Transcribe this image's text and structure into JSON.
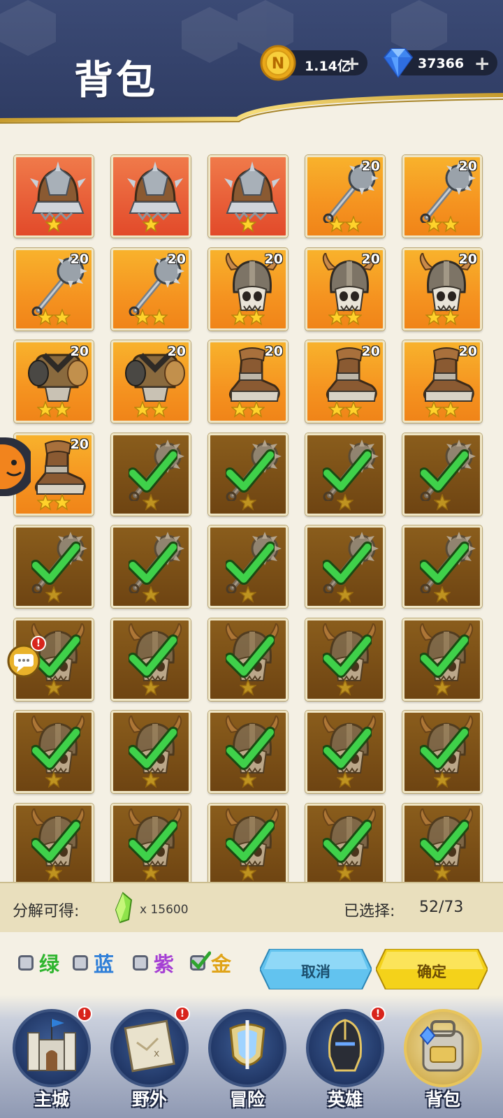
{
  "header": {
    "title": "背包",
    "gold": {
      "value": "1.14亿",
      "icon": "gold-coin-icon",
      "add_icon": "plus-icon"
    },
    "diamond": {
      "value": "37366",
      "icon": "diamond-icon",
      "add_icon": "plus-icon"
    }
  },
  "items": [
    {
      "type": "helmet-spiked",
      "rarity": "red",
      "stars": 1,
      "level": "",
      "selected": false
    },
    {
      "type": "helmet-spiked",
      "rarity": "red",
      "stars": 1,
      "level": "",
      "selected": false
    },
    {
      "type": "helmet-spiked",
      "rarity": "red",
      "stars": 1,
      "level": "",
      "selected": false
    },
    {
      "type": "mace",
      "rarity": "orange",
      "stars": 2,
      "level": "20",
      "selected": false
    },
    {
      "type": "mace",
      "rarity": "orange",
      "stars": 2,
      "level": "20",
      "selected": false
    },
    {
      "type": "mace",
      "rarity": "orange",
      "stars": 2,
      "level": "20",
      "selected": false
    },
    {
      "type": "mace",
      "rarity": "orange",
      "stars": 2,
      "level": "20",
      "selected": false
    },
    {
      "type": "horned-helmet",
      "rarity": "orange",
      "stars": 2,
      "level": "20",
      "selected": false
    },
    {
      "type": "horned-helmet",
      "rarity": "orange",
      "stars": 2,
      "level": "20",
      "selected": false
    },
    {
      "type": "horned-helmet",
      "rarity": "orange",
      "stars": 2,
      "level": "20",
      "selected": false
    },
    {
      "type": "chest-armor",
      "rarity": "orange",
      "stars": 2,
      "level": "20",
      "selected": false
    },
    {
      "type": "chest-armor",
      "rarity": "orange",
      "stars": 2,
      "level": "20",
      "selected": false
    },
    {
      "type": "boot",
      "rarity": "orange",
      "stars": 2,
      "level": "20",
      "selected": false
    },
    {
      "type": "boot",
      "rarity": "orange",
      "stars": 2,
      "level": "20",
      "selected": false
    },
    {
      "type": "boot",
      "rarity": "orange",
      "stars": 2,
      "level": "20",
      "selected": false
    },
    {
      "type": "boot",
      "rarity": "orange",
      "stars": 2,
      "level": "20",
      "selected": false
    },
    {
      "type": "mace",
      "rarity": "gold",
      "stars": 1,
      "level": "",
      "selected": true
    },
    {
      "type": "mace",
      "rarity": "gold",
      "stars": 1,
      "level": "",
      "selected": true
    },
    {
      "type": "mace",
      "rarity": "gold",
      "stars": 1,
      "level": "",
      "selected": true
    },
    {
      "type": "mace",
      "rarity": "gold",
      "stars": 1,
      "level": "",
      "selected": true
    },
    {
      "type": "mace",
      "rarity": "gold",
      "stars": 1,
      "level": "",
      "selected": true
    },
    {
      "type": "mace",
      "rarity": "gold",
      "stars": 1,
      "level": "",
      "selected": true
    },
    {
      "type": "mace",
      "rarity": "gold",
      "stars": 1,
      "level": "",
      "selected": true
    },
    {
      "type": "mace",
      "rarity": "gold",
      "stars": 1,
      "level": "",
      "selected": true
    },
    {
      "type": "mace",
      "rarity": "gold",
      "stars": 1,
      "level": "",
      "selected": true
    },
    {
      "type": "horned-helmet",
      "rarity": "gold",
      "stars": 1,
      "level": "",
      "selected": true
    },
    {
      "type": "horned-helmet",
      "rarity": "gold",
      "stars": 1,
      "level": "",
      "selected": true
    },
    {
      "type": "horned-helmet",
      "rarity": "gold",
      "stars": 1,
      "level": "",
      "selected": true
    },
    {
      "type": "horned-helmet",
      "rarity": "gold",
      "stars": 1,
      "level": "",
      "selected": true
    },
    {
      "type": "horned-helmet",
      "rarity": "gold",
      "stars": 1,
      "level": "",
      "selected": true
    },
    {
      "type": "horned-helmet",
      "rarity": "gold",
      "stars": 1,
      "level": "",
      "selected": true
    },
    {
      "type": "horned-helmet",
      "rarity": "gold",
      "stars": 1,
      "level": "",
      "selected": true
    },
    {
      "type": "horned-helmet",
      "rarity": "gold",
      "stars": 1,
      "level": "",
      "selected": true
    },
    {
      "type": "horned-helmet",
      "rarity": "gold",
      "stars": 1,
      "level": "",
      "selected": true
    },
    {
      "type": "horned-helmet",
      "rarity": "gold",
      "stars": 1,
      "level": "",
      "selected": true
    },
    {
      "type": "horned-helmet",
      "rarity": "gold",
      "stars": 1,
      "level": "",
      "selected": true
    },
    {
      "type": "horned-helmet",
      "rarity": "gold",
      "stars": 1,
      "level": "",
      "selected": true
    },
    {
      "type": "horned-helmet",
      "rarity": "gold",
      "stars": 1,
      "level": "",
      "selected": true
    },
    {
      "type": "horned-helmet",
      "rarity": "gold",
      "stars": 1,
      "level": "",
      "selected": true
    },
    {
      "type": "horned-helmet",
      "rarity": "gold",
      "stars": 1,
      "level": "",
      "selected": true
    }
  ],
  "decompose": {
    "label": "分解可得:",
    "crystal_icon": "green-crystal-icon",
    "amount": "x 15600",
    "selected_label": "已选择:",
    "selected_value": "52/73"
  },
  "filters": [
    {
      "label": "绿",
      "color": "#2fb52f",
      "checked": false
    },
    {
      "label": "蓝",
      "color": "#2f7fd8",
      "checked": false
    },
    {
      "label": "紫",
      "color": "#a53fd4",
      "checked": false
    },
    {
      "label": "金",
      "color": "#e0a419",
      "checked": true
    }
  ],
  "buttons": {
    "cancel": "取消",
    "confirm": "确定"
  },
  "nav": [
    {
      "label": "主城",
      "icon": "castle-icon",
      "badge": "!",
      "active": false
    },
    {
      "label": "野外",
      "icon": "map-scroll-icon",
      "badge": "!",
      "active": false
    },
    {
      "label": "冒险",
      "icon": "sword-shield-icon",
      "badge": "",
      "active": false
    },
    {
      "label": "英雄",
      "icon": "knight-helmet-icon",
      "badge": "!",
      "active": false
    },
    {
      "label": "背包",
      "icon": "backpack-icon",
      "badge": "",
      "active": true
    }
  ],
  "side_widgets": {
    "pet": "pet-avatar-icon",
    "chat": "chat-bubble-icon",
    "chat_badge": "!"
  }
}
